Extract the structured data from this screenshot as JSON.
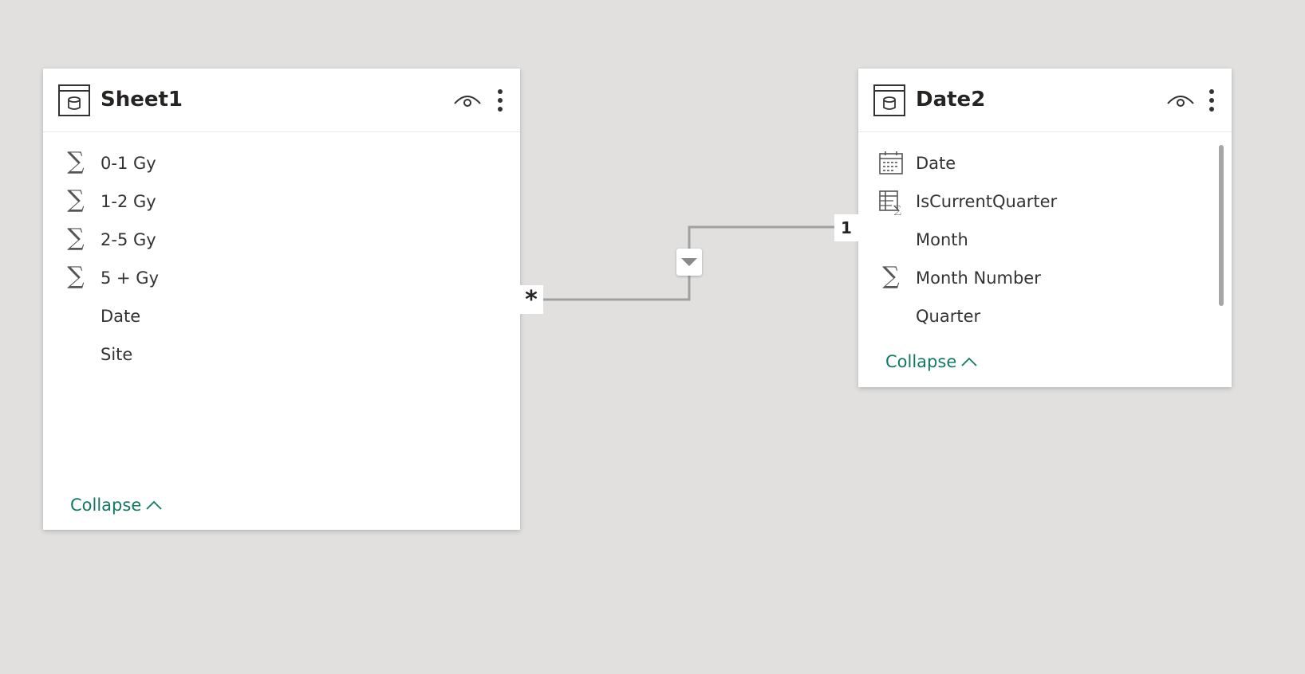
{
  "tables": [
    {
      "title": "Sheet1",
      "fields": [
        {
          "label": "0-1 Gy",
          "icon": "sigma-icon"
        },
        {
          "label": "1-2 Gy",
          "icon": "sigma-icon"
        },
        {
          "label": "2-5 Gy",
          "icon": "sigma-icon"
        },
        {
          "label": "5 + Gy",
          "icon": "sigma-icon"
        },
        {
          "label": "Date",
          "icon": ""
        },
        {
          "label": "Site",
          "icon": ""
        }
      ],
      "collapse_label": "Collapse"
    },
    {
      "title": "Date2",
      "fields": [
        {
          "label": "Date",
          "icon": "calendar-icon"
        },
        {
          "label": "IsCurrentQuarter",
          "icon": "calculated-column-icon"
        },
        {
          "label": "Month",
          "icon": ""
        },
        {
          "label": "Month Number",
          "icon": "sigma-icon"
        },
        {
          "label": "Quarter",
          "icon": ""
        }
      ],
      "collapse_label": "Collapse"
    }
  ],
  "relationship": {
    "from_cardinality": "*",
    "to_cardinality": "1",
    "filter_direction": "single"
  },
  "colors": {
    "canvas": "#e1e0df",
    "card": "#ffffff",
    "collapse_link": "#117865",
    "relationship_line": "#a0a0a0"
  }
}
